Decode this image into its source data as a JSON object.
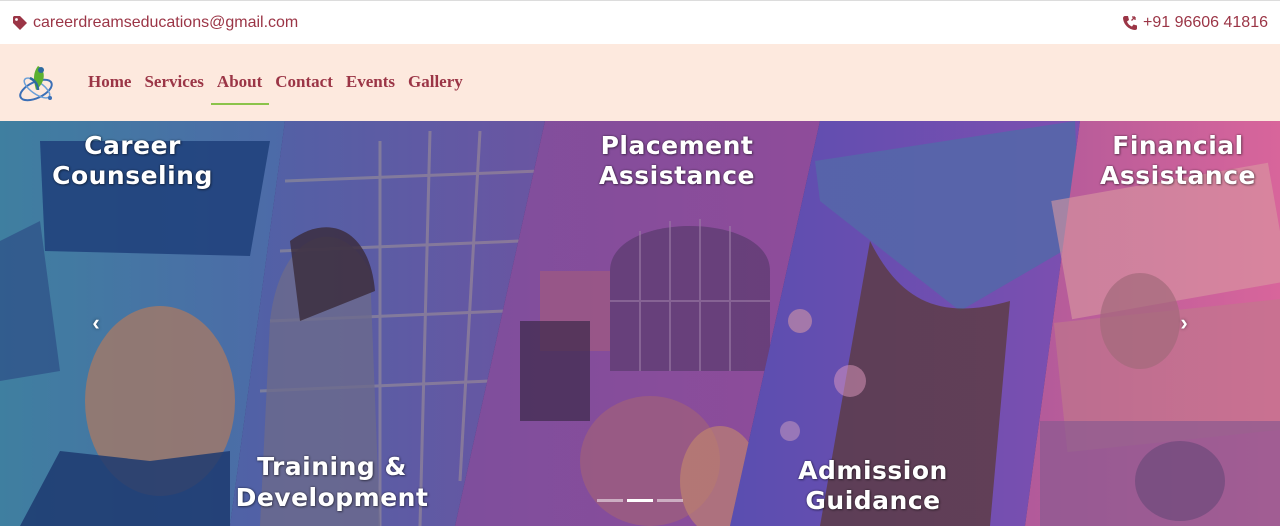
{
  "topbar": {
    "email": "careerdreamseducations@gmail.com",
    "phone": "+91 96606 41816",
    "email_icon": "tag-icon",
    "phone_icon": "phone-icon"
  },
  "nav": {
    "items": [
      {
        "label": "Home",
        "active": false
      },
      {
        "label": "Services",
        "active": false
      },
      {
        "label": "About",
        "active": true
      },
      {
        "label": "Contact",
        "active": false
      },
      {
        "label": "Events",
        "active": false
      },
      {
        "label": "Gallery",
        "active": false
      }
    ]
  },
  "hero": {
    "panels": [
      {
        "line1": "Career",
        "line2": "Counseling"
      },
      {
        "line1": "Placement",
        "line2": "Assistance"
      },
      {
        "line1": "Financial",
        "line2": "Assistance"
      },
      {
        "line1": "Training &",
        "line2": "Development"
      },
      {
        "line1": "Admission",
        "line2": "Guidance"
      }
    ],
    "prev_icon": "chevron-left-icon",
    "next_icon": "chevron-right-icon",
    "prev_glyph": "‹",
    "next_glyph": "›",
    "slide_count": 3,
    "active_slide": 2
  },
  "colors": {
    "brand": "#9b3546",
    "nav_bg": "#fde9de",
    "active_underline": "#8bc34a"
  }
}
